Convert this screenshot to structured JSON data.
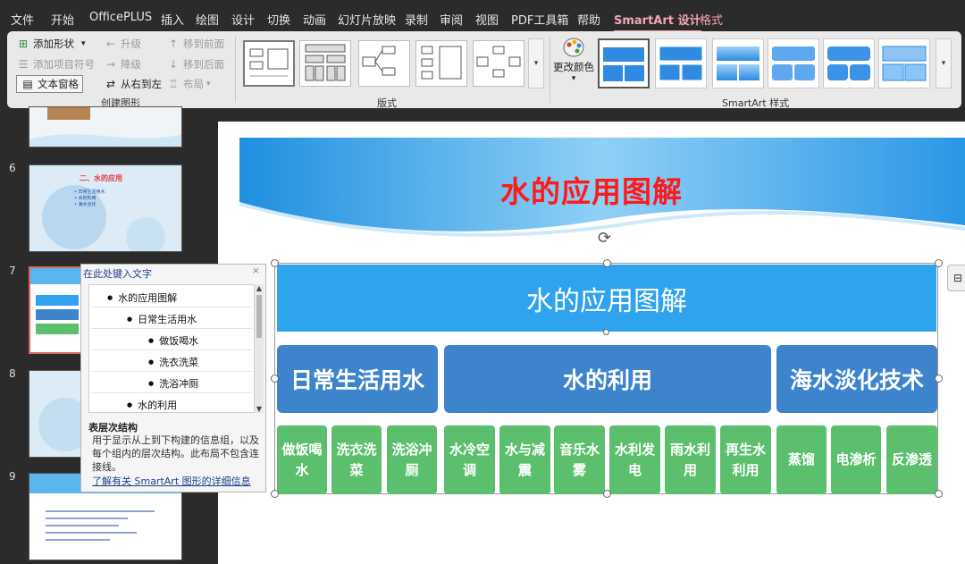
{
  "menu": {
    "tabs": [
      "文件",
      "开始",
      "OfficePLUS",
      "插入",
      "绘图",
      "设计",
      "切换",
      "动画",
      "幻灯片放映",
      "录制",
      "审阅",
      "视图",
      "PDF工具箱",
      "帮助",
      "SmartArt 设计",
      "格式"
    ],
    "active": "SmartArt 设计"
  },
  "ribbon": {
    "create": {
      "add_shape": "添加形状",
      "add_bullet": "添加项目符号",
      "text_pane": "文本窗格",
      "promote": "升级",
      "demote": "降级",
      "right_to_left": "从右到左",
      "move_up": "移到前面",
      "move_down": "移到后面",
      "layout": "布局",
      "group_label": "创建图形"
    },
    "layouts_label": "版式",
    "change_colors": "更改颜色",
    "styles_label": "SmartArt 样式"
  },
  "slides": [
    {
      "number": "6",
      "title": "二、水的应用",
      "bullets": [
        "• 日常生活用水",
        "• 水的利用",
        "• 海水淡化"
      ]
    },
    {
      "number": "7"
    },
    {
      "number": "8"
    },
    {
      "number": "9"
    }
  ],
  "slide": {
    "title": "水的应用图解",
    "smartart": {
      "root": "水的应用图解",
      "branches": [
        {
          "label": "日常生活用水",
          "leaves": [
            "做饭喝水",
            "洗衣洗菜",
            "洗浴冲厕"
          ]
        },
        {
          "label": "水的利用",
          "leaves": [
            "水冷空调",
            "水与减震",
            "音乐水雾",
            "水利发电",
            "雨水利用",
            "再生水利用"
          ]
        },
        {
          "label": "海水淡化技术",
          "leaves": [
            "蒸馏",
            "电渗析",
            "反渗透"
          ]
        }
      ]
    }
  },
  "text_pane": {
    "title": "在此处键入文字",
    "items": [
      "水的应用图解",
      "日常生活用水",
      "做饭喝水",
      "洗衣洗菜",
      "洗浴冲厕",
      "水的利用"
    ],
    "desc_title": "表层次结构",
    "desc": "用于显示从上到下构建的信息组，以及每个组内的层次结构。此布局不包含连接线。",
    "link": "了解有关 SmartArt 图形的详细信息"
  },
  "colors": {
    "title_red": "#ff1a1a",
    "root_blue": "#2fa3ee",
    "branch_blue": "#3e84cc",
    "leaf_green": "#5cbf6e"
  }
}
